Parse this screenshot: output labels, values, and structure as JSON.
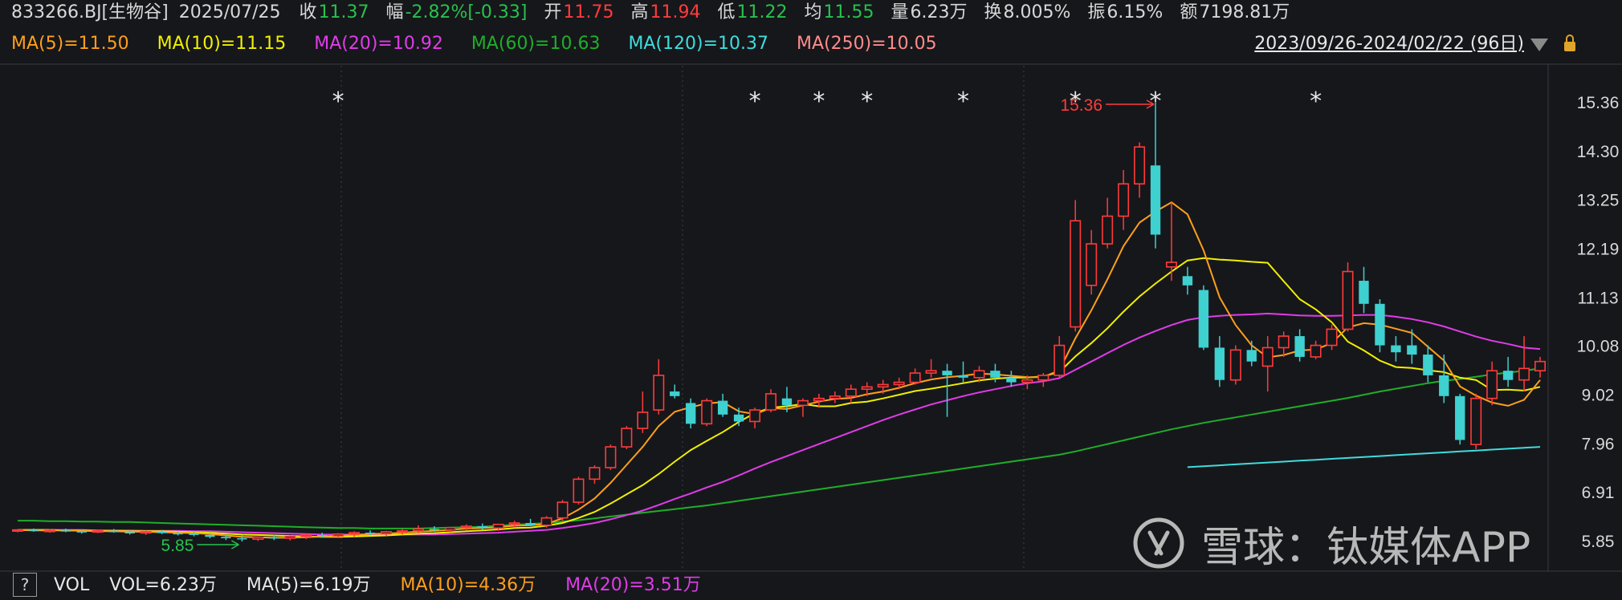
{
  "header": {
    "code": "833266.BJ[生物谷]",
    "date": "2025/07/25",
    "close_label": "收",
    "close": "11.37",
    "change_label": "幅",
    "change": "-2.82%[-0.33]",
    "open_label": "开",
    "open": "11.75",
    "high_label": "高",
    "high": "11.94",
    "low_label": "低",
    "low": "11.22",
    "avg_label": "均",
    "avg": "11.55",
    "volume_label": "量",
    "volume": "6.23万",
    "turnover_label": "换",
    "turnover": "8.005%",
    "amplitude_label": "振",
    "amplitude": "6.15%",
    "amount_label": "额",
    "amount": "7198.81万"
  },
  "ma_legend": {
    "ma5": "MA(5)=11.50",
    "ma10": "MA(10)=11.15",
    "ma20": "MA(20)=10.92",
    "ma60": "MA(60)=10.63",
    "ma120": "MA(120)=10.37",
    "ma250": "MA(250)=10.05"
  },
  "range_text": "2023/09/26-2024/02/22 (96日)",
  "volume_bar": {
    "help": "?",
    "label": "VOL",
    "vol": "VOL=6.23万",
    "ma5": "MA(5)=6.19万",
    "ma10": "MA(10)=4.36万",
    "ma20": "MA(20)=3.51万"
  },
  "watermark": "雪球：钛媒体APP",
  "colors": {
    "up": "#ff3b3b",
    "down": "#3fd0d0",
    "ma5": "#ff9f1a",
    "ma10": "#f0f000",
    "ma20": "#e03ce8",
    "ma60": "#1fae2a",
    "ma120": "#3fdcdc",
    "ma250": "#ff8c8c",
    "green_text": "#27c24c",
    "red_text": "#ff3b3b"
  },
  "chart_data": {
    "type": "candlestick",
    "y_ticks": [
      "15.36",
      "14.30",
      "13.25",
      "12.19",
      "11.13",
      "10.08",
      "9.02",
      "7.96",
      "6.91",
      "5.85"
    ],
    "ylim": [
      5.5,
      16.0
    ],
    "high_marker": "15.36",
    "low_marker": "5.85",
    "ohlc": [
      [
        6.08,
        6.12,
        6.05,
        6.1
      ],
      [
        6.1,
        6.13,
        6.06,
        6.08
      ],
      [
        6.08,
        6.12,
        6.04,
        6.09
      ],
      [
        6.09,
        6.13,
        6.05,
        6.07
      ],
      [
        6.07,
        6.11,
        6.02,
        6.06
      ],
      [
        6.06,
        6.1,
        6.03,
        6.08
      ],
      [
        6.08,
        6.12,
        6.04,
        6.05
      ],
      [
        6.05,
        6.09,
        6.0,
        6.04
      ],
      [
        6.04,
        6.08,
        5.99,
        6.06
      ],
      [
        6.06,
        6.1,
        6.01,
        6.03
      ],
      [
        6.03,
        6.07,
        5.98,
        6.02
      ],
      [
        6.02,
        6.06,
        5.96,
        5.99
      ],
      [
        5.99,
        6.04,
        5.92,
        5.95
      ],
      [
        5.95,
        6.0,
        5.88,
        5.92
      ],
      [
        5.92,
        5.98,
        5.85,
        5.9
      ],
      [
        5.9,
        5.96,
        5.86,
        5.94
      ],
      [
        5.94,
        5.99,
        5.88,
        5.92
      ],
      [
        5.92,
        5.98,
        5.87,
        5.96
      ],
      [
        5.96,
        6.02,
        5.9,
        5.99
      ],
      [
        5.99,
        6.04,
        5.93,
        5.97
      ],
      [
        5.97,
        6.03,
        5.92,
        6.01
      ],
      [
        6.01,
        6.07,
        5.95,
        6.04
      ],
      [
        6.04,
        6.09,
        5.98,
        6.02
      ],
      [
        6.02,
        6.08,
        5.97,
        6.06
      ],
      [
        6.06,
        6.12,
        6.0,
        6.08
      ],
      [
        6.08,
        6.2,
        6.03,
        6.12
      ],
      [
        6.12,
        6.18,
        6.06,
        6.1
      ],
      [
        6.1,
        6.16,
        6.05,
        6.15
      ],
      [
        6.15,
        6.22,
        6.09,
        6.18
      ],
      [
        6.18,
        6.24,
        6.1,
        6.14
      ],
      [
        6.14,
        6.2,
        6.08,
        6.22
      ],
      [
        6.22,
        6.3,
        6.15,
        6.25
      ],
      [
        6.25,
        6.34,
        6.18,
        6.2
      ],
      [
        6.2,
        6.4,
        6.15,
        6.36
      ],
      [
        6.36,
        6.75,
        6.3,
        6.7
      ],
      [
        6.7,
        7.25,
        6.65,
        7.2
      ],
      [
        7.2,
        7.5,
        7.1,
        7.45
      ],
      [
        7.45,
        7.95,
        7.4,
        7.9
      ],
      [
        7.9,
        8.35,
        7.85,
        8.3
      ],
      [
        8.3,
        9.1,
        8.2,
        8.65
      ],
      [
        8.7,
        9.8,
        8.6,
        9.45
      ],
      [
        9.1,
        9.25,
        8.95,
        9.0
      ],
      [
        8.85,
        8.95,
        8.3,
        8.4
      ],
      [
        8.4,
        8.95,
        8.35,
        8.9
      ],
      [
        8.9,
        9.05,
        8.55,
        8.6
      ],
      [
        8.6,
        8.75,
        8.35,
        8.45
      ],
      [
        8.45,
        8.75,
        8.3,
        8.7
      ],
      [
        8.7,
        9.15,
        8.65,
        9.05
      ],
      [
        8.95,
        9.2,
        8.65,
        8.8
      ],
      [
        8.8,
        8.95,
        8.55,
        8.9
      ],
      [
        8.9,
        9.05,
        8.75,
        8.95
      ],
      [
        8.95,
        9.1,
        8.85,
        9.0
      ],
      [
        9.0,
        9.25,
        8.85,
        9.15
      ],
      [
        9.15,
        9.3,
        9.0,
        9.2
      ],
      [
        9.2,
        9.35,
        9.05,
        9.25
      ],
      [
        9.25,
        9.4,
        9.15,
        9.3
      ],
      [
        9.3,
        9.6,
        9.25,
        9.5
      ],
      [
        9.5,
        9.8,
        9.4,
        9.55
      ],
      [
        9.55,
        9.7,
        8.55,
        9.45
      ],
      [
        9.45,
        9.75,
        9.3,
        9.4
      ],
      [
        9.4,
        9.65,
        9.3,
        9.55
      ],
      [
        9.55,
        9.7,
        9.3,
        9.4
      ],
      [
        9.4,
        9.55,
        9.2,
        9.3
      ],
      [
        9.3,
        9.45,
        9.15,
        9.35
      ],
      [
        9.35,
        9.5,
        9.2,
        9.45
      ],
      [
        9.45,
        10.3,
        9.4,
        10.1
      ],
      [
        10.5,
        13.25,
        10.4,
        12.8
      ],
      [
        11.4,
        12.6,
        11.2,
        12.3
      ],
      [
        12.3,
        13.3,
        12.2,
        12.9
      ],
      [
        12.9,
        13.9,
        12.6,
        13.6
      ],
      [
        13.6,
        14.5,
        13.3,
        14.4
      ],
      [
        14.0,
        15.36,
        12.2,
        12.5
      ],
      [
        11.8,
        13.2,
        11.5,
        11.9
      ],
      [
        11.6,
        11.8,
        11.2,
        11.4
      ],
      [
        11.3,
        11.4,
        10.0,
        10.05
      ],
      [
        10.05,
        10.3,
        9.2,
        9.35
      ],
      [
        9.35,
        10.1,
        9.25,
        10.0
      ],
      [
        10.0,
        10.2,
        9.65,
        9.75
      ],
      [
        9.65,
        10.3,
        9.1,
        10.05
      ],
      [
        10.05,
        10.4,
        9.85,
        10.3
      ],
      [
        10.3,
        10.45,
        9.75,
        9.85
      ],
      [
        9.85,
        10.2,
        9.8,
        10.1
      ],
      [
        10.1,
        10.55,
        10.0,
        10.45
      ],
      [
        10.45,
        11.9,
        10.4,
        11.7
      ],
      [
        11.5,
        11.8,
        10.8,
        11.0
      ],
      [
        11.0,
        11.1,
        9.95,
        10.1
      ],
      [
        10.1,
        10.3,
        9.75,
        9.95
      ],
      [
        10.1,
        10.45,
        9.7,
        9.9
      ],
      [
        9.9,
        10.1,
        9.3,
        9.45
      ],
      [
        9.45,
        9.9,
        8.85,
        9.0
      ],
      [
        9.0,
        9.05,
        7.95,
        8.05
      ],
      [
        7.95,
        9.05,
        7.85,
        8.95
      ],
      [
        8.95,
        9.75,
        8.8,
        9.55
      ],
      [
        9.55,
        9.85,
        9.2,
        9.35
      ],
      [
        9.35,
        10.3,
        9.1,
        9.6
      ],
      [
        9.55,
        9.85,
        9.4,
        9.75
      ]
    ],
    "ma5": [
      6.1,
      6.09,
      6.09,
      6.09,
      6.08,
      6.07,
      6.07,
      6.06,
      6.06,
      6.05,
      6.04,
      6.03,
      6.01,
      5.98,
      5.95,
      5.94,
      5.93,
      5.93,
      5.94,
      5.96,
      5.97,
      5.99,
      6.01,
      6.02,
      6.04,
      6.06,
      6.08,
      6.1,
      6.13,
      6.14,
      6.16,
      6.19,
      6.2,
      6.23,
      6.35,
      6.54,
      6.78,
      7.12,
      7.51,
      7.9,
      8.35,
      8.66,
      8.76,
      8.84,
      8.87,
      8.67,
      8.61,
      8.74,
      8.72,
      8.8,
      8.88,
      8.94,
      8.96,
      9.04,
      9.1,
      9.18,
      9.28,
      9.36,
      9.41,
      9.44,
      9.49,
      9.47,
      9.44,
      9.41,
      9.41,
      9.56,
      10.25,
      10.86,
      11.53,
      12.25,
      12.76,
      13.0,
      13.2,
      12.94,
      12.16,
      11.14,
      10.54,
      10.1,
      9.84,
      9.89,
      9.99,
      10.01,
      10.15,
      10.49,
      10.58,
      10.55,
      10.46,
      10.37,
      10.07,
      9.77,
      9.21,
      9.01,
      8.86,
      8.79,
      8.92,
      9.35
    ],
    "ma10": [
      6.1,
      6.1,
      6.1,
      6.09,
      6.09,
      6.08,
      6.08,
      6.07,
      6.07,
      6.07,
      6.06,
      6.05,
      6.04,
      6.02,
      6.0,
      5.99,
      5.98,
      5.97,
      5.96,
      5.95,
      5.95,
      5.96,
      5.97,
      5.98,
      6.0,
      6.02,
      6.03,
      6.05,
      6.07,
      6.09,
      6.11,
      6.14,
      6.15,
      6.19,
      6.25,
      6.36,
      6.49,
      6.67,
      6.87,
      7.07,
      7.31,
      7.58,
      7.83,
      8.03,
      8.22,
      8.44,
      8.63,
      8.75,
      8.78,
      8.83,
      8.78,
      8.78,
      8.85,
      8.88,
      8.95,
      9.03,
      9.11,
      9.16,
      9.22,
      9.28,
      9.34,
      9.38,
      9.4,
      9.4,
      9.43,
      9.52,
      9.86,
      10.15,
      10.47,
      10.83,
      11.16,
      11.44,
      11.7,
      11.94,
      11.99,
      11.96,
      11.94,
      11.91,
      11.89,
      11.49,
      11.1,
      10.88,
      10.6,
      10.18,
      9.99,
      9.77,
      9.63,
      9.61,
      9.56,
      9.52,
      9.4,
      9.35,
      9.13,
      9.14,
      9.12,
      9.2
    ],
    "ma20": [
      6.1,
      6.1,
      6.1,
      6.1,
      6.1,
      6.09,
      6.09,
      6.09,
      6.08,
      6.08,
      6.08,
      6.07,
      6.07,
      6.06,
      6.05,
      6.04,
      6.03,
      6.02,
      6.01,
      6.0,
      6.0,
      6.0,
      6.0,
      6.0,
      6.0,
      6.0,
      6.0,
      6.01,
      6.02,
      6.03,
      6.04,
      6.06,
      6.08,
      6.1,
      6.14,
      6.19,
      6.25,
      6.33,
      6.42,
      6.52,
      6.64,
      6.77,
      6.89,
      7.02,
      7.14,
      7.28,
      7.43,
      7.57,
      7.7,
      7.83,
      7.96,
      8.09,
      8.22,
      8.35,
      8.48,
      8.6,
      8.71,
      8.82,
      8.91,
      9.0,
      9.08,
      9.15,
      9.22,
      9.28,
      9.32,
      9.39,
      9.57,
      9.75,
      9.93,
      10.11,
      10.27,
      10.41,
      10.54,
      10.65,
      10.71,
      10.74,
      10.76,
      10.77,
      10.79,
      10.77,
      10.75,
      10.74,
      10.74,
      10.75,
      10.76,
      10.76,
      10.72,
      10.67,
      10.6,
      10.51,
      10.4,
      10.29,
      10.2,
      10.13,
      10.05,
      10.02
    ],
    "ma60": [
      6.3,
      6.3,
      6.29,
      6.29,
      6.28,
      6.28,
      6.27,
      6.27,
      6.26,
      6.25,
      6.24,
      6.23,
      6.22,
      6.21,
      6.2,
      6.19,
      6.18,
      6.17,
      6.16,
      6.15,
      6.14,
      6.14,
      6.13,
      6.13,
      6.13,
      6.13,
      6.14,
      6.15,
      6.16,
      6.17,
      6.19,
      6.21,
      6.23,
      6.25,
      6.28,
      6.31,
      6.35,
      6.39,
      6.43,
      6.47,
      6.51,
      6.55,
      6.59,
      6.63,
      6.68,
      6.73,
      6.78,
      6.83,
      6.88,
      6.93,
      6.98,
      7.03,
      7.08,
      7.13,
      7.18,
      7.23,
      7.28,
      7.33,
      7.38,
      7.43,
      7.48,
      7.53,
      7.58,
      7.63,
      7.68,
      7.73,
      7.8,
      7.88,
      7.96,
      8.04,
      8.12,
      8.2,
      8.28,
      8.35,
      8.42,
      8.48,
      8.54,
      8.6,
      8.66,
      8.72,
      8.78,
      8.84,
      8.9,
      8.96,
      9.03,
      9.1,
      9.16,
      9.22,
      9.28,
      9.33,
      9.37,
      9.42,
      9.47,
      9.51,
      9.55,
      9.6
    ],
    "ma120_start_index": 73,
    "ma120": [
      7.46,
      7.48,
      7.5,
      7.52,
      7.54,
      7.56,
      7.58,
      7.6,
      7.62,
      7.64,
      7.66,
      7.68,
      7.7,
      7.72,
      7.74,
      7.76,
      7.78,
      7.8,
      7.82,
      7.84,
      7.86,
      7.88,
      7.9
    ],
    "star_indices": [
      20,
      46,
      50,
      53,
      59,
      66,
      71,
      81
    ]
  }
}
